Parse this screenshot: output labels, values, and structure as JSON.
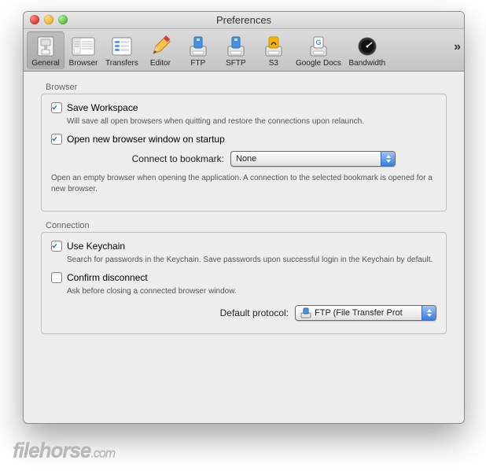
{
  "window": {
    "title": "Preferences"
  },
  "toolbar": {
    "items": [
      {
        "label": "General"
      },
      {
        "label": "Browser"
      },
      {
        "label": "Transfers"
      },
      {
        "label": "Editor"
      },
      {
        "label": "FTP"
      },
      {
        "label": "SFTP"
      },
      {
        "label": "S3"
      },
      {
        "label": "Google Docs"
      },
      {
        "label": "Bandwidth"
      }
    ],
    "overflow": "»"
  },
  "groups": {
    "browser": {
      "title": "Browser",
      "save_workspace_label": "Save Workspace",
      "save_workspace_desc": "Will save all open browsers when quitting and restore the connections upon relaunch.",
      "open_new_label": "Open new browser window on startup",
      "connect_label": "Connect to bookmark:",
      "connect_value": "None",
      "connect_desc": "Open an empty browser when opening the application. A connection to the selected bookmark is opened for a new browser."
    },
    "connection": {
      "title": "Connection",
      "keychain_label": "Use Keychain",
      "keychain_desc": "Search for passwords in the Keychain. Save passwords upon successful login in the Keychain by default.",
      "confirm_label": "Confirm disconnect",
      "confirm_desc": "Ask before closing a connected browser window.",
      "protocol_label": "Default protocol:",
      "protocol_value": "FTP (File Transfer Prot"
    }
  },
  "watermark": {
    "brand": "filehorse",
    "tld": ".com"
  }
}
